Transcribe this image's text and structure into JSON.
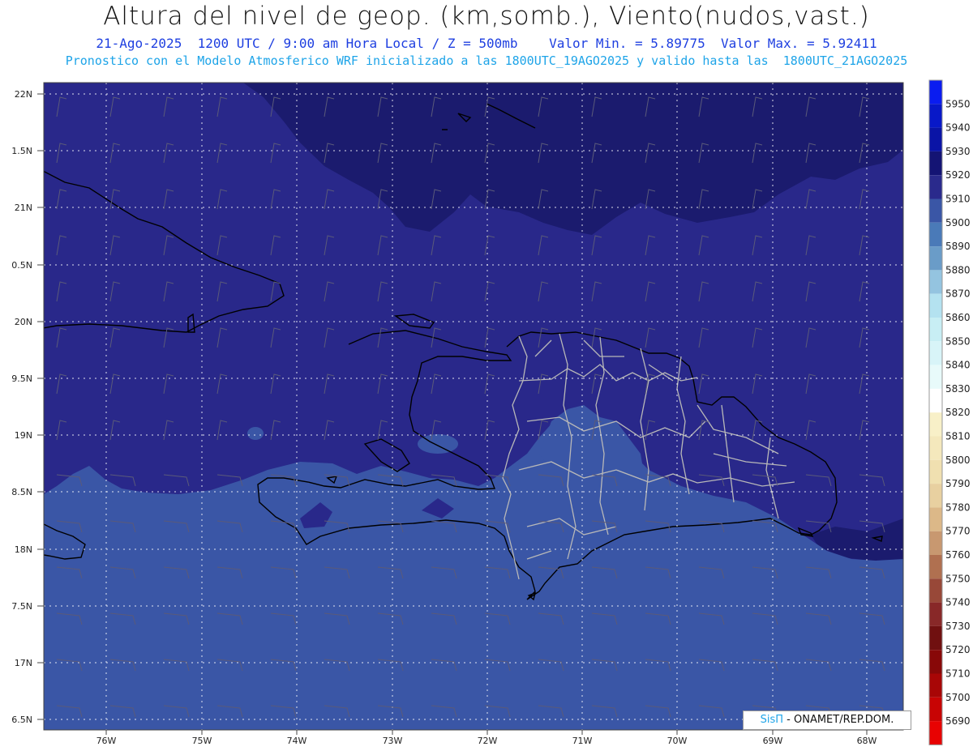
{
  "title": "Altura del nivel de geop. (km,somb.), Viento(nudos,vast.)",
  "subtitle1": "21-Ago-2025  1200 UTC / 9:00 am Hora Local / Z = 500mb    Valor Min. = 5.89775  Valor Max. = 5.92411",
  "subtitle2": "Pronostico con el Modelo Atmosferico WRF inicializado a las 1800UTC_19AGO2025 y valido hasta las  1800UTC_21AGO2025",
  "credit": {
    "brand": "SisΠ",
    "text": "- ONAMET/REP.DOM."
  },
  "chart_data": {
    "type": "heatmap",
    "lat_labels": [
      "22N",
      "1.5N",
      "21N",
      "0.5N",
      "20N",
      "9.5N",
      "19N",
      "8.5N",
      "18N",
      "7.5N",
      "17N",
      "6.5N"
    ],
    "lon_labels": [
      "76W",
      "75W",
      "74W",
      "73W",
      "72W",
      "71W",
      "70W",
      "69W",
      "68W"
    ],
    "colorbar": {
      "levels": [
        5950,
        5940,
        5930,
        5920,
        5910,
        5900,
        5890,
        5880,
        5870,
        5860,
        5850,
        5840,
        5830,
        5820,
        5810,
        5800,
        5790,
        5780,
        5770,
        5760,
        5750,
        5740,
        5730,
        5720,
        5710,
        5700,
        5690
      ],
      "colors": [
        "#0a1cf0",
        "#0818c8",
        "#0a14a6",
        "#141474",
        "#2a2a8c",
        "#3a56a6",
        "#4a7ab8",
        "#6a9cc8",
        "#94c4e0",
        "#b4e2f0",
        "#c8eef4",
        "#d8f4f8",
        "#e8fafa",
        "#ffffff",
        "#f8f0c8",
        "#f4e8bc",
        "#f0e0b0",
        "#e8d0a0",
        "#dcb888",
        "#c89870",
        "#b07050",
        "#984838",
        "#882828",
        "#701010",
        "#880808",
        "#a80606",
        "#c80404",
        "#e80202"
      ]
    },
    "fill_colors": {
      "dark": "#1b1b6e",
      "mid": "#29288a",
      "light": "#3a56a6"
    }
  }
}
